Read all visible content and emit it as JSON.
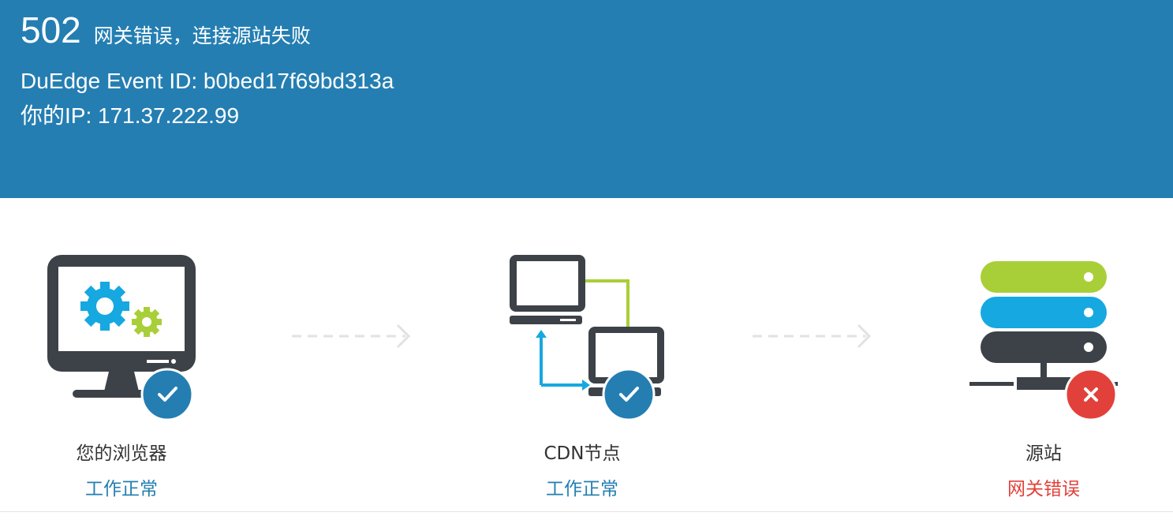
{
  "header": {
    "code": "502",
    "message": "网关错误，连接源站失败",
    "event_id": "DuEdge Event ID: b0bed17f69bd313a",
    "ip": "你的IP: 171.37.222.99",
    "background_color": "#247eb2"
  },
  "steps": [
    {
      "label": "您的浏览器",
      "status": "工作正常",
      "status_state": "ok",
      "icon": "browser-monitor-icon",
      "badge_icon": "check-icon"
    },
    {
      "label": "CDN节点",
      "status": "工作正常",
      "status_state": "ok",
      "icon": "cdn-network-icon",
      "badge_icon": "check-icon"
    },
    {
      "label": "源站",
      "status": "网关错误",
      "status_state": "error",
      "icon": "server-stack-icon",
      "badge_icon": "close-icon"
    }
  ],
  "colors": {
    "ok": "#247eb2",
    "error": "#e1413a",
    "dark": "#3d4248",
    "green": "#a9cf38",
    "cyan": "#16a8e0"
  }
}
